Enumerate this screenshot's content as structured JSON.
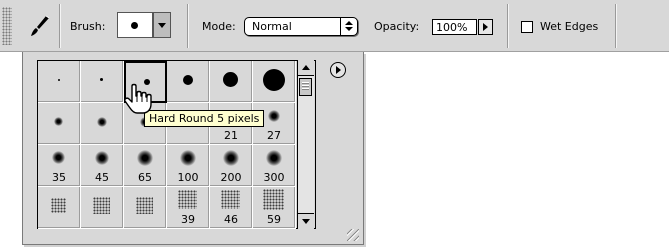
{
  "options_bar": {
    "tool_icon": "brush-tool-icon",
    "brush_label": "Brush:",
    "mode_label": "Mode:",
    "mode_value": "Normal",
    "opacity_label": "Opacity:",
    "opacity_value": "100%",
    "wet_edges_label": "Wet Edges",
    "wet_edges_checked": false
  },
  "brush_picker": {
    "rows": [
      [
        {
          "kind": "hard",
          "size": 1,
          "label": ""
        },
        {
          "kind": "hard",
          "size": 3,
          "label": ""
        },
        {
          "kind": "hard",
          "size": 5,
          "label": "",
          "selected": true
        },
        {
          "kind": "hard",
          "size": 9,
          "label": ""
        },
        {
          "kind": "hard",
          "size": 13,
          "label": ""
        },
        {
          "kind": "hard",
          "size": 19,
          "label": ""
        }
      ],
      [
        {
          "kind": "soft",
          "size": 5,
          "label": ""
        },
        {
          "kind": "soft",
          "size": 9,
          "label": ""
        },
        {
          "kind": "soft",
          "size": 13,
          "label": ""
        },
        {
          "kind": "soft",
          "size": 17,
          "label": ""
        },
        {
          "kind": "soft",
          "size": 21,
          "label": "21"
        },
        {
          "kind": "soft",
          "size": 27,
          "label": "27"
        }
      ],
      [
        {
          "kind": "soft",
          "size": 35,
          "label": "35"
        },
        {
          "kind": "soft",
          "size": 45,
          "label": "45"
        },
        {
          "kind": "soft",
          "size": 65,
          "label": "65"
        },
        {
          "kind": "soft",
          "size": 100,
          "label": "100"
        },
        {
          "kind": "soft",
          "size": 200,
          "label": "200"
        },
        {
          "kind": "soft",
          "size": 300,
          "label": "300"
        }
      ],
      [
        {
          "kind": "scatter",
          "size": 14,
          "label": ""
        },
        {
          "kind": "scatter",
          "size": 24,
          "label": ""
        },
        {
          "kind": "scatter",
          "size": 27,
          "label": ""
        },
        {
          "kind": "scatter",
          "size": 39,
          "label": "39"
        },
        {
          "kind": "scatter",
          "size": 46,
          "label": "46"
        },
        {
          "kind": "scatter",
          "size": 59,
          "label": "59"
        }
      ]
    ],
    "tooltip": "Hard Round 5 pixels",
    "menu_icon": "flyout-menu-icon",
    "cursor_icon": "pointing-hand-cursor-icon"
  }
}
